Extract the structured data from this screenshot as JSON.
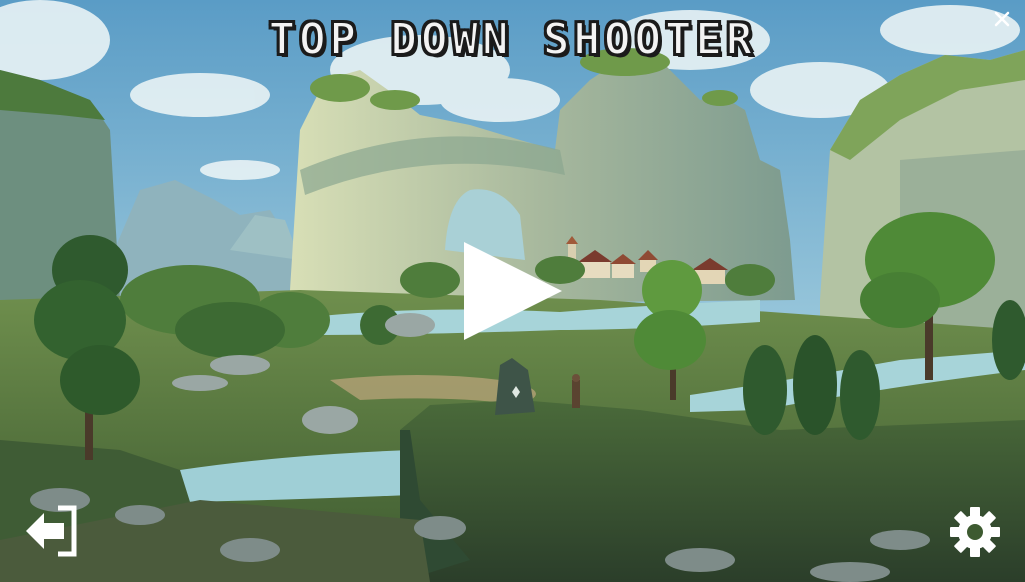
{
  "game": {
    "title": "TOP DOWN SHOOTER"
  },
  "controls": {
    "close": {
      "icon": "close-icon"
    },
    "play": {
      "icon": "play-icon"
    },
    "exit": {
      "icon": "exit-door-icon"
    },
    "settings": {
      "icon": "gear-icon"
    }
  },
  "colors": {
    "sky": "#7fb6d6",
    "cliff": "#b9c7a6",
    "foliage": "#3f7a3a",
    "river": "#8ec6cf",
    "title_fill": "#f3f3f3",
    "title_outline": "#1b1b1b",
    "button_white": "#ffffff"
  }
}
